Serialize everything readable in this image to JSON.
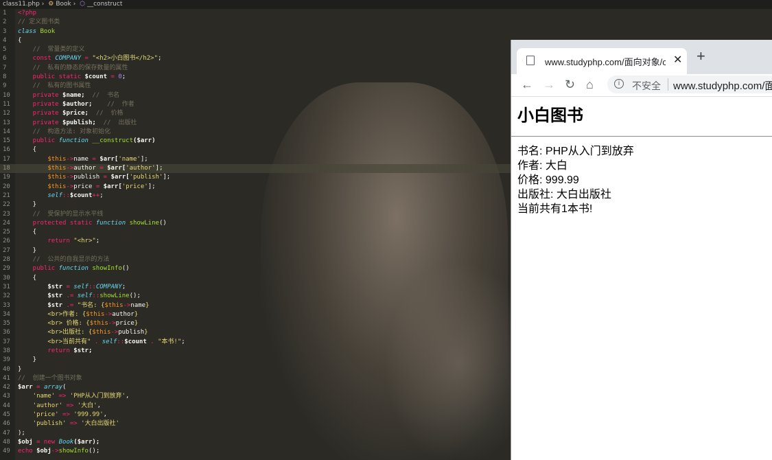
{
  "breadcrumb": [
    "class11.php",
    "Book",
    "__construct"
  ],
  "code_lines": [
    {
      "n": "1",
      "segs": [
        [
          "kw",
          "<?php"
        ]
      ]
    },
    {
      "n": "2",
      "segs": [
        [
          "cm",
          "// 定义图书类"
        ]
      ]
    },
    {
      "n": "3",
      "segs": [
        [
          "it",
          "class "
        ],
        [
          "fn",
          "Book"
        ]
      ]
    },
    {
      "n": "4",
      "segs": [
        [
          "pl",
          "{"
        ]
      ]
    },
    {
      "n": "5",
      "segs": [
        [
          "cm",
          "    //  常量类的定义"
        ]
      ]
    },
    {
      "n": "6",
      "segs": [
        [
          "kw",
          "    const "
        ],
        [
          "it",
          "COMPANY"
        ],
        [
          "kw",
          " = "
        ],
        [
          "st",
          "\"<h2>小白图书</h2>\""
        ],
        [
          "pl",
          ";"
        ]
      ]
    },
    {
      "n": "7",
      "segs": [
        [
          "cm",
          "    //  私有的静态的保存数量的属性"
        ]
      ]
    },
    {
      "n": "8",
      "segs": [
        [
          "kw",
          "    public static "
        ],
        [
          "pl",
          "$count "
        ],
        [
          "kw",
          "= "
        ],
        [
          "nm",
          "0"
        ],
        [
          "pl",
          ";"
        ]
      ]
    },
    {
      "n": "9",
      "segs": [
        [
          "cm",
          "    //  私有的图书属性"
        ]
      ]
    },
    {
      "n": "10",
      "segs": [
        [
          "kw",
          "    private "
        ],
        [
          "pl",
          "$name;  "
        ],
        [
          "cm",
          "//  书名"
        ]
      ]
    },
    {
      "n": "11",
      "segs": [
        [
          "kw",
          "    private "
        ],
        [
          "pl",
          "$author;    "
        ],
        [
          "cm",
          "//  作者"
        ]
      ]
    },
    {
      "n": "12",
      "segs": [
        [
          "kw",
          "    private "
        ],
        [
          "pl",
          "$price;  "
        ],
        [
          "cm",
          "//  价格"
        ]
      ]
    },
    {
      "n": "13",
      "segs": [
        [
          "kw",
          "    private "
        ],
        [
          "pl",
          "$publish;  "
        ],
        [
          "cm",
          "//  出版社"
        ]
      ]
    },
    {
      "n": "14",
      "segs": [
        [
          "cm",
          "    //  构造方法: 对象初始化"
        ]
      ]
    },
    {
      "n": "15",
      "segs": [
        [
          "kw",
          "    public "
        ],
        [
          "it",
          "function "
        ],
        [
          "fn",
          "__construct"
        ],
        [
          "pl",
          "($arr)"
        ]
      ]
    },
    {
      "n": "16",
      "segs": [
        [
          "pl",
          "    {"
        ]
      ]
    },
    {
      "n": "17",
      "segs": [
        [
          "vr",
          "        $this"
        ],
        [
          "kw",
          "->"
        ],
        [
          "pl",
          "name "
        ],
        [
          "kw",
          "= "
        ],
        [
          "pl",
          "$arr["
        ],
        [
          "st",
          "'name'"
        ],
        [
          "pl",
          "];"
        ]
      ]
    },
    {
      "n": "18",
      "segs": [
        [
          "vr",
          "        $this"
        ],
        [
          "kw",
          "->"
        ],
        [
          "pl",
          "author "
        ],
        [
          "kw",
          "= "
        ],
        [
          "pl",
          "$arr["
        ],
        [
          "st",
          "'author'"
        ],
        [
          "pl",
          "];"
        ]
      ],
      "active": true
    },
    {
      "n": "19",
      "segs": [
        [
          "vr",
          "        $this"
        ],
        [
          "kw",
          "->"
        ],
        [
          "pl",
          "publish "
        ],
        [
          "kw",
          "= "
        ],
        [
          "pl",
          "$arr["
        ],
        [
          "st",
          "'publish'"
        ],
        [
          "pl",
          "];"
        ]
      ]
    },
    {
      "n": "20",
      "segs": [
        [
          "vr",
          "        $this"
        ],
        [
          "kw",
          "->"
        ],
        [
          "pl",
          "price "
        ],
        [
          "kw",
          "= "
        ],
        [
          "pl",
          "$arr["
        ],
        [
          "st",
          "'price'"
        ],
        [
          "pl",
          "];"
        ]
      ]
    },
    {
      "n": "21",
      "segs": [
        [
          "it",
          "        self"
        ],
        [
          "kw",
          "::"
        ],
        [
          "pl",
          "$count"
        ],
        [
          "kw",
          "++"
        ],
        [
          "pl",
          ";"
        ]
      ]
    },
    {
      "n": "22",
      "segs": [
        [
          "pl",
          "    }"
        ]
      ]
    },
    {
      "n": "23",
      "segs": [
        [
          "cm",
          "    //  受保护的显示水平线"
        ]
      ]
    },
    {
      "n": "24",
      "segs": [
        [
          "kw",
          "    protected static "
        ],
        [
          "it",
          "function "
        ],
        [
          "fn",
          "showLine"
        ],
        [
          "pl",
          "()"
        ]
      ]
    },
    {
      "n": "25",
      "segs": [
        [
          "pl",
          "    {"
        ]
      ]
    },
    {
      "n": "26",
      "segs": [
        [
          "kw",
          "        return "
        ],
        [
          "st",
          "\"<hr>\""
        ],
        [
          "pl",
          ";"
        ]
      ]
    },
    {
      "n": "27",
      "segs": [
        [
          "pl",
          "    }"
        ]
      ]
    },
    {
      "n": "28",
      "segs": [
        [
          "cm",
          "    //  公共的自我显示的方法"
        ]
      ]
    },
    {
      "n": "29",
      "segs": [
        [
          "kw",
          "    public "
        ],
        [
          "it",
          "function "
        ],
        [
          "fn",
          "showInfo"
        ],
        [
          "pl",
          "()"
        ]
      ]
    },
    {
      "n": "30",
      "segs": [
        [
          "pl",
          "    {"
        ]
      ]
    },
    {
      "n": "31",
      "segs": [
        [
          "pl",
          "        $str "
        ],
        [
          "kw",
          "= "
        ],
        [
          "it",
          "self"
        ],
        [
          "kw",
          "::"
        ],
        [
          "it",
          "COMPANY"
        ],
        [
          "pl",
          ";"
        ]
      ]
    },
    {
      "n": "32",
      "segs": [
        [
          "pl",
          "        $str "
        ],
        [
          "kw",
          ".= "
        ],
        [
          "it",
          "self"
        ],
        [
          "kw",
          "::"
        ],
        [
          "fn",
          "showLine"
        ],
        [
          "pl",
          "();"
        ]
      ]
    },
    {
      "n": "33",
      "segs": [
        [
          "pl",
          "        $str "
        ],
        [
          "kw",
          ".= "
        ],
        [
          "st",
          "\"书名: {"
        ],
        [
          "vr",
          "$this"
        ],
        [
          "kw",
          "->"
        ],
        [
          "pl",
          "name"
        ],
        [
          "st",
          "}"
        ]
      ]
    },
    {
      "n": "34",
      "segs": [
        [
          "st",
          "        <br>作者: {"
        ],
        [
          "vr",
          "$this"
        ],
        [
          "kw",
          "->"
        ],
        [
          "pl",
          "author"
        ],
        [
          "st",
          "}"
        ]
      ]
    },
    {
      "n": "35",
      "segs": [
        [
          "st",
          "        <br> 价格: {"
        ],
        [
          "vr",
          "$this"
        ],
        [
          "kw",
          "->"
        ],
        [
          "pl",
          "price"
        ],
        [
          "st",
          "}"
        ]
      ]
    },
    {
      "n": "36",
      "segs": [
        [
          "st",
          "        <br>出版社: {"
        ],
        [
          "vr",
          "$this"
        ],
        [
          "kw",
          "->"
        ],
        [
          "pl",
          "publish"
        ],
        [
          "st",
          "}"
        ]
      ]
    },
    {
      "n": "37",
      "segs": [
        [
          "st",
          "        <br>当前共有\" "
        ],
        [
          "kw",
          ". "
        ],
        [
          "it",
          "self"
        ],
        [
          "kw",
          "::"
        ],
        [
          "pl",
          "$count "
        ],
        [
          "kw",
          ". "
        ],
        [
          "st",
          "\"本书!\""
        ],
        [
          "pl",
          ";"
        ]
      ]
    },
    {
      "n": "38",
      "segs": [
        [
          "kw",
          "        return "
        ],
        [
          "pl",
          "$str;"
        ]
      ]
    },
    {
      "n": "39",
      "segs": [
        [
          "pl",
          "    }"
        ]
      ]
    },
    {
      "n": "40",
      "segs": [
        [
          "pl",
          "}"
        ]
      ]
    },
    {
      "n": "41",
      "segs": [
        [
          "cm",
          "//  创建一个图书对象"
        ]
      ]
    },
    {
      "n": "42",
      "segs": [
        [
          "pl",
          "$arr "
        ],
        [
          "kw",
          "= "
        ],
        [
          "it",
          "array"
        ],
        [
          "pl",
          "("
        ]
      ]
    },
    {
      "n": "43",
      "segs": [
        [
          "st",
          "    'name' "
        ],
        [
          "kw",
          "=> "
        ],
        [
          "st",
          "'PHP从入门到放弃'"
        ],
        [
          "pl",
          ","
        ]
      ]
    },
    {
      "n": "44",
      "segs": [
        [
          "st",
          "    'author' "
        ],
        [
          "kw",
          "=> "
        ],
        [
          "st",
          "'大白'"
        ],
        [
          "pl",
          ","
        ]
      ]
    },
    {
      "n": "45",
      "segs": [
        [
          "st",
          "    'price' "
        ],
        [
          "kw",
          "=> "
        ],
        [
          "st",
          "'999.99'"
        ],
        [
          "pl",
          ","
        ]
      ]
    },
    {
      "n": "46",
      "segs": [
        [
          "st",
          "    'publish' "
        ],
        [
          "kw",
          "=> "
        ],
        [
          "st",
          "'大白出版社'"
        ]
      ]
    },
    {
      "n": "47",
      "segs": [
        [
          "pl",
          ");"
        ]
      ]
    },
    {
      "n": "48",
      "segs": [
        [
          "pl",
          "$obj "
        ],
        [
          "kw",
          "= new "
        ],
        [
          "it",
          "Book"
        ],
        [
          "pl",
          "($arr);"
        ]
      ]
    },
    {
      "n": "49",
      "segs": [
        [
          "kw",
          "echo "
        ],
        [
          "pl",
          "$obj"
        ],
        [
          "kw",
          "->"
        ],
        [
          "fn",
          "showInfo"
        ],
        [
          "pl",
          "();"
        ]
      ]
    }
  ],
  "browser": {
    "tab_title": "www.studyphp.com/面向对象/cl",
    "close_glyph": "✕",
    "newtab_glyph": "+",
    "back_glyph": "←",
    "forward_glyph": "→",
    "reload_glyph": "↻",
    "home_glyph": "⌂",
    "info_glyph": "i",
    "insecure_label": "不安全",
    "url": "www.studyphp.com/面"
  },
  "page": {
    "heading": "小白图书",
    "rows": [
      "书名: PHP从入门到放弃",
      "作者: 大白",
      "价格: 999.99",
      "出版社: 大白出版社",
      "当前共有1本书!"
    ]
  },
  "colors": {
    "keyword": "#f92672",
    "string": "#e6db74",
    "comment": "#75715e",
    "storage": "#66d9ef",
    "function": "#a6e22e",
    "variable": "#fd971f",
    "number": "#ae81ff"
  },
  "icons": [
    "file-icon",
    "class-icon",
    "method-icon",
    "page-favicon-icon",
    "back-arrow-icon",
    "forward-arrow-icon",
    "reload-icon",
    "home-icon",
    "info-icon",
    "close-tab-icon",
    "new-tab-icon"
  ]
}
